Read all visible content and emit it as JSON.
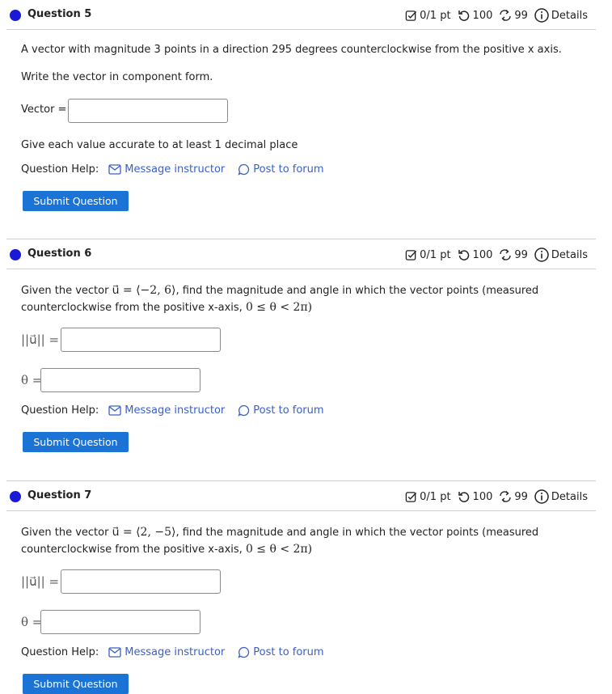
{
  "colors": {
    "accent": "#1a1ad6",
    "button": "#1c73d6",
    "link": "#3a5fc8"
  },
  "meta": {
    "score": "0/1 pt",
    "retries": "100",
    "attempts": "99",
    "details": "Details"
  },
  "help": {
    "label": "Question Help:",
    "message": "Message instructor",
    "forum": "Post to forum"
  },
  "submit_label": "Submit Question",
  "q5": {
    "title": "Question 5",
    "prompt": "A vector with magnitude 3 points in a direction 295 degrees counterclockwise from the positive x axis.",
    "instruction": "Write the vector in component form.",
    "vector_label": "Vector =",
    "vector_value": "",
    "accuracy_note": "Give each value accurate to at least 1 decimal place"
  },
  "q6": {
    "title": "Question 6",
    "prompt_pre": "Given the vector",
    "vector_expr": "u⃗ = ⟨−2, 6⟩",
    "prompt_post": ", find the magnitude and angle in which the vector points (measured",
    "prompt_line2_pre": "counterclockwise from the positive x-axis,",
    "range_expr": "0 ≤ θ < 2π)",
    "magnitude_label": "||u⃗|| =",
    "magnitude_value": "",
    "theta_label": "θ =",
    "theta_value": ""
  },
  "q7": {
    "title": "Question 7",
    "prompt_pre": "Given the vector",
    "vector_expr": "u⃗ = ⟨2, −5⟩",
    "prompt_post": ", find the magnitude and angle in which the vector points (measured",
    "prompt_line2_pre": "counterclockwise from the positive x-axis,",
    "range_expr": "0 ≤ θ < 2π)",
    "magnitude_label": "||u⃗|| =",
    "magnitude_value": "",
    "theta_label": "θ =",
    "theta_value": ""
  }
}
